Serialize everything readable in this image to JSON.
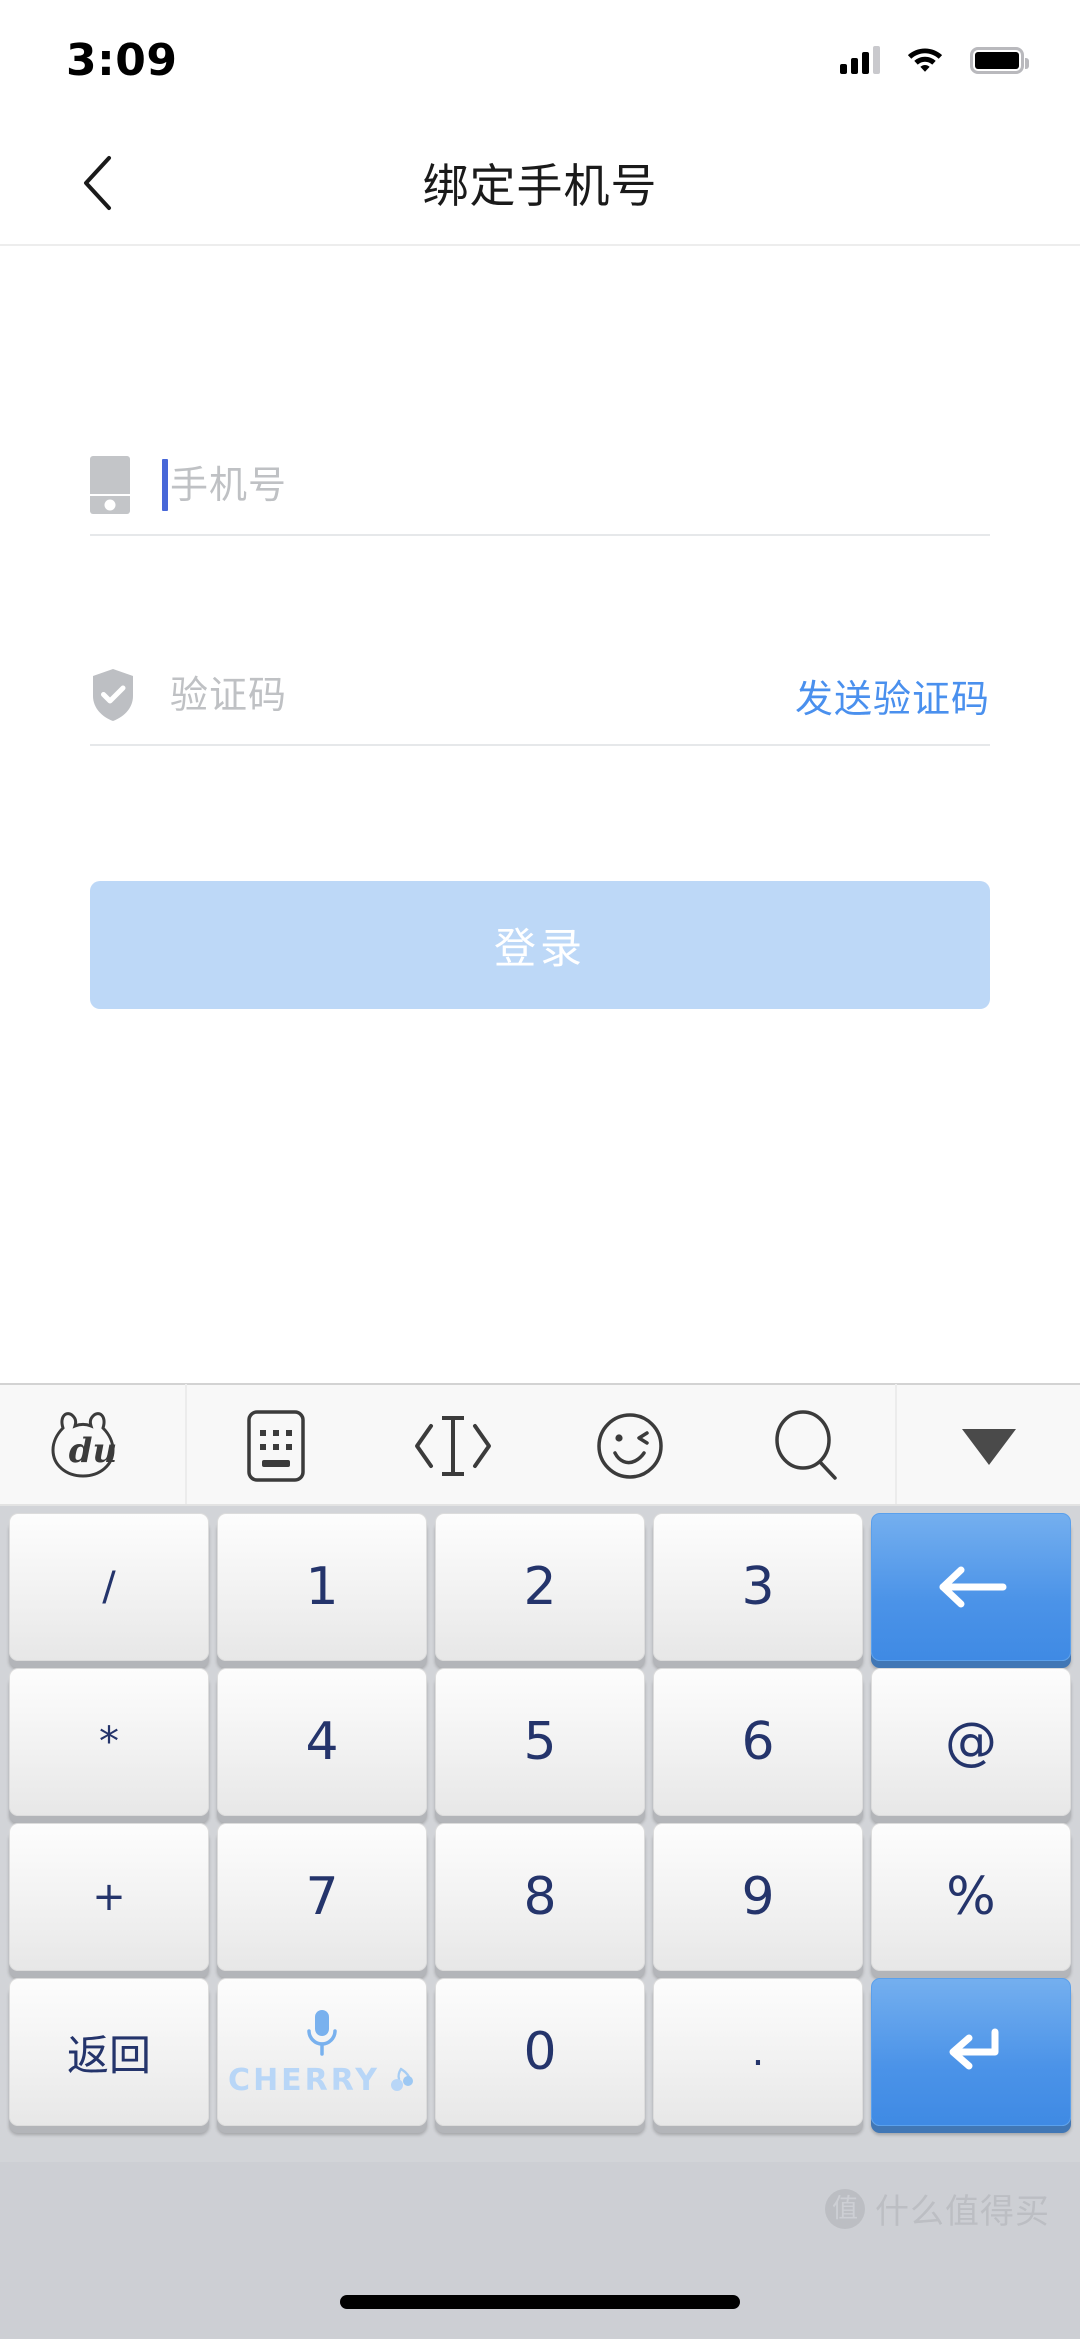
{
  "status_bar": {
    "time": "3:09",
    "signal_icon": "signal-bars-icon",
    "signal_bars_filled": 3,
    "signal_bars_total": 4,
    "wifi_icon": "wifi-icon",
    "battery_icon": "battery-full-icon"
  },
  "nav": {
    "back_icon": "chevron-left-icon",
    "title": "绑定手机号"
  },
  "form": {
    "phone": {
      "icon": "mobile-phone-icon",
      "placeholder": "手机号",
      "value": "",
      "focused": true
    },
    "code": {
      "icon": "shield-check-icon",
      "placeholder": "验证码",
      "value": "",
      "send_label": "发送验证码",
      "send_color": "#4a90ee"
    },
    "submit": {
      "label": "登录",
      "enabled": false,
      "bg_color": "#bdd8f7",
      "text_color": "#ffffff"
    }
  },
  "keyboard": {
    "toolbar": [
      {
        "name": "baidu-logo-icon",
        "label": "du"
      },
      {
        "name": "keyboard-icon",
        "label": ""
      },
      {
        "name": "cursor-move-icon",
        "label": ""
      },
      {
        "name": "emoji-icon",
        "label": ""
      },
      {
        "name": "search-icon",
        "label": ""
      },
      {
        "name": "collapse-keyboard-icon",
        "label": ""
      }
    ],
    "rows": [
      [
        {
          "label": "/",
          "name": "key-slash",
          "style": "narrow sym"
        },
        {
          "label": "1",
          "name": "key-1",
          "style": "wide"
        },
        {
          "label": "2",
          "name": "key-2",
          "style": "wide"
        },
        {
          "label": "3",
          "name": "key-3",
          "style": "wide"
        },
        {
          "label": "",
          "name": "key-backspace",
          "style": "narrow blue",
          "icon": "backspace-arrow-icon"
        }
      ],
      [
        {
          "label": "*",
          "name": "key-asterisk",
          "style": "narrow sym"
        },
        {
          "label": "4",
          "name": "key-4",
          "style": "wide"
        },
        {
          "label": "5",
          "name": "key-5",
          "style": "wide"
        },
        {
          "label": "6",
          "name": "key-6",
          "style": "wide"
        },
        {
          "label": "@",
          "name": "key-at",
          "style": "narrow"
        }
      ],
      [
        {
          "label": "+",
          "name": "key-plus",
          "style": "narrow sym"
        },
        {
          "label": "7",
          "name": "key-7",
          "style": "wide"
        },
        {
          "label": "8",
          "name": "key-8",
          "style": "wide"
        },
        {
          "label": "9",
          "name": "key-9",
          "style": "wide"
        },
        {
          "label": "%",
          "name": "key-percent",
          "style": "narrow"
        }
      ],
      [
        {
          "label": "返回",
          "name": "key-return-cjk",
          "style": "narrow cjk"
        },
        {
          "label": "",
          "name": "key-voice-cherry",
          "style": "wide",
          "icon": "microphone-icon",
          "brand": "CHERRY"
        },
        {
          "label": "0",
          "name": "key-0",
          "style": "wide"
        },
        {
          "label": ".",
          "name": "key-period",
          "style": "wide"
        },
        {
          "label": "",
          "name": "key-enter",
          "style": "narrow blue",
          "icon": "enter-arrow-icon"
        }
      ]
    ],
    "brand_label": "CHERRY",
    "accent_blue": "#4b93e8"
  },
  "watermark": {
    "logo_text": "值",
    "text": "什么值得买"
  }
}
